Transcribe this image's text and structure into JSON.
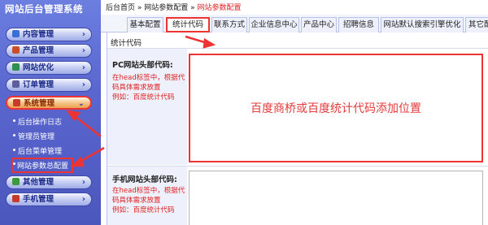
{
  "sidebar": {
    "title": "网站后台管理系统",
    "menus": [
      {
        "label": "内容管理",
        "icon": "content-icon",
        "color": "#3b6fd6"
      },
      {
        "label": "产品管理",
        "icon": "product-icon",
        "color": "#c94f2b"
      },
      {
        "label": "网站优化",
        "icon": "chart-icon",
        "color": "#2f8f4c"
      },
      {
        "label": "订单管理",
        "icon": "order-icon",
        "color": "#5e5e9e"
      },
      {
        "label": "系统管理",
        "icon": "tools-icon",
        "color": "#c83a2a"
      },
      {
        "label": "其他管理",
        "icon": "puzzle-icon",
        "color": "#3b9a3b"
      },
      {
        "label": "手机管理",
        "icon": "tools-icon",
        "color": "#c83a2a"
      }
    ],
    "submenu": [
      "后台操作日志",
      "管理员管理",
      "后台菜单管理",
      "网站参数总配置"
    ]
  },
  "breadcrumb": {
    "home": "后台首页",
    "sep1": " » ",
    "level2": "网站参数配置",
    "sep2": " » ",
    "current": "网站参数配置"
  },
  "tabs": [
    "基本配置",
    "统计代码",
    "联系方式",
    "企业信息中心",
    "产品中心",
    "招聘信息",
    "网站默认搜索引擎优化",
    "其它配"
  ],
  "panel": {
    "section_title": "统计代码",
    "pc": {
      "label": "PC网站头部代码:",
      "hint_1": "在head标签中，根据代",
      "hint_2": "码具体需求放置",
      "hint_3": "例如：百度统计代码",
      "textarea_content": "百度商桥或百度统计代码添加位置"
    },
    "mobile": {
      "label": "手机网站头部代码:",
      "hint_1": "在head标签中，根据代",
      "hint_2": "码具体需求放置",
      "hint_3": "例如：百度统计代码"
    }
  },
  "colors": {
    "highlight": "#e33333",
    "hint_red": "#d22222",
    "sidebar_blue": "#5a67cf"
  }
}
